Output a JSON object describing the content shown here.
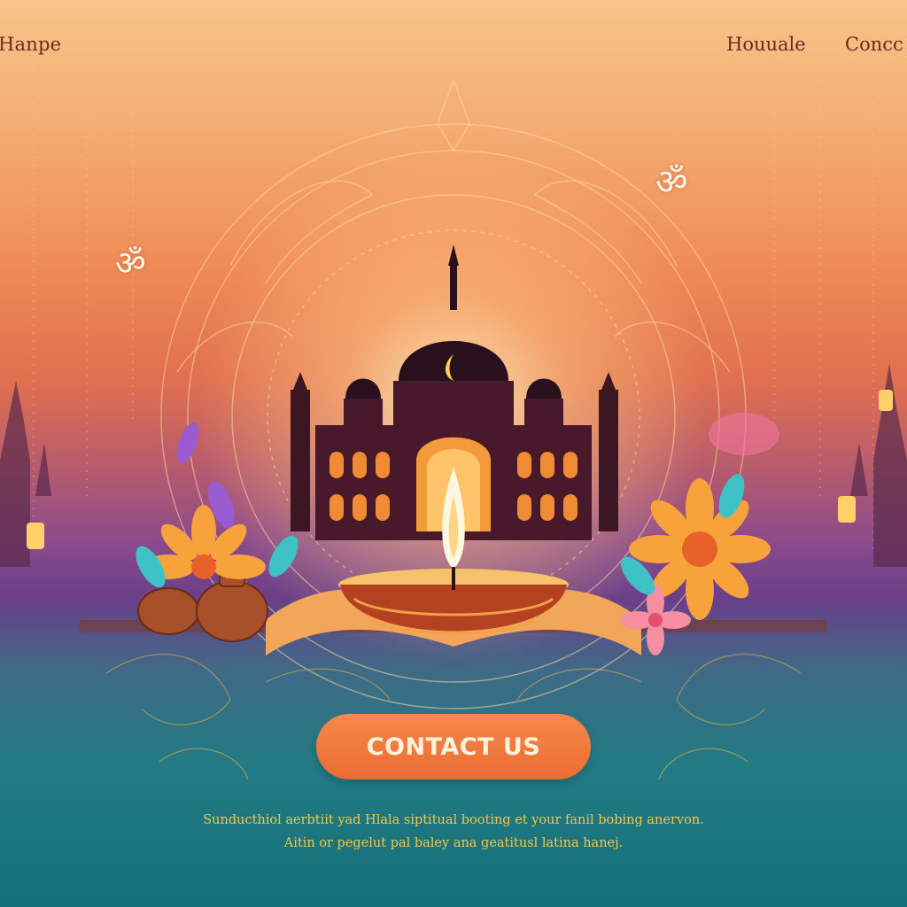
{
  "header": {
    "brand": "Hanpe",
    "nav": [
      {
        "label": "Houuale"
      },
      {
        "label": "Concc"
      }
    ]
  },
  "decor": {
    "om_symbol": "ॐ",
    "icons": [
      "om-icon",
      "temple-icon",
      "diya-icon",
      "flower-icon",
      "lantern-icon"
    ]
  },
  "hero": {
    "cta_label": "CONTACT US",
    "tagline_line1": "Sunducthiol aerbtiit yad Hlala siptitual booting et your fanil bobing anervon.",
    "tagline_line2": "Aitin or pegelut pal baley ana geatitusl latina hanej."
  },
  "colors": {
    "accent": "#ec6d33",
    "nav_text": "#6b2a1b",
    "tagline": "#f3c64a",
    "sky_top": "#f6c489",
    "teal_bottom": "#14707a"
  }
}
